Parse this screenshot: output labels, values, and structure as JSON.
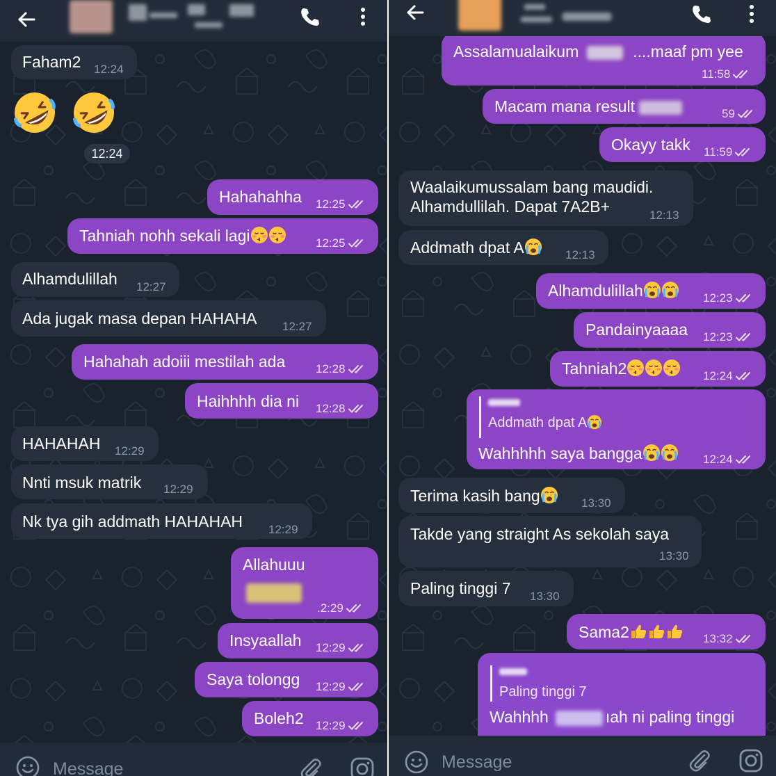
{
  "colors": {
    "background": "#1a222d",
    "header": "#222c39",
    "incoming_bubble": "#262f3c",
    "outgoing_bubble": "#8c45c4",
    "time_incoming": "#8c98a5",
    "time_outgoing": "#eadbf5"
  },
  "icons": {
    "back": "arrow-left-icon",
    "call": "phone-icon",
    "menu": "more-vertical-icon",
    "emoji": "smile-icon",
    "attach": "paperclip-icon",
    "camera": "instagram-camera-icon",
    "read": "double-check-icon"
  },
  "left": {
    "composer": {
      "placeholder": "Message"
    },
    "messages": [
      {
        "text": "Faham2",
        "time": "12:24"
      },
      {
        "emoji": "rolling-on-floor-laughing",
        "count": 2,
        "time": "12:24"
      },
      {
        "text": "Hahahahha",
        "time": "12:25",
        "read": true
      },
      {
        "text": "Tahniah nohh sekali lagi",
        "emoji": "kissing-blushing",
        "time": "12:25",
        "read": true
      },
      {
        "text": "Alhamdulillah",
        "time": "12:27"
      },
      {
        "text": "Ada jugak masa depan HAHAHA",
        "time": "12:27"
      },
      {
        "text": "Hahahah adoiii mestilah ada",
        "time": "12:28",
        "read": true
      },
      {
        "text": "Haihhhh dia ni",
        "time": "12:28",
        "read": true
      },
      {
        "text": "HAHAHAH",
        "time": "12:29"
      },
      {
        "text": "Nnti msuk matrik",
        "time": "12:29"
      },
      {
        "text": "Nk tya gih addmath HAHAHAH",
        "time": "12:29"
      },
      {
        "text": "Allahuuu",
        "time": ".2:29",
        "read": true
      },
      {
        "text": "Insyaallah",
        "time": "12:29",
        "read": true
      },
      {
        "text": "Saya tolongg",
        "time": "12:29",
        "read": true
      },
      {
        "text": "Boleh2",
        "time": "12:29",
        "read": true
      }
    ]
  },
  "right": {
    "composer": {
      "placeholder": "Message"
    },
    "messages": [
      {
        "text_a": "Assalamualaikum",
        "text_b": "....maaf pm yee",
        "time": "11:58",
        "read": true
      },
      {
        "text": "Macam mana result",
        "time": "59",
        "read": true
      },
      {
        "text": "Okayy takk",
        "time": "11:59",
        "read": true
      },
      {
        "line1": "Waalaikumussalam bang maudidi.",
        "line2": "Alhamdullilah. Dapat 7A2B+",
        "time": "12:13"
      },
      {
        "text": "Addmath dpat A",
        "emoji": "crying",
        "time": "12:13"
      },
      {
        "text": "Alhamdulillah",
        "emoji": "crying",
        "time": "12:23",
        "read": true
      },
      {
        "text": "Pandainyaaaa",
        "time": "12:23",
        "read": true
      },
      {
        "text": "Tahniah2",
        "emoji": "kissing-blushing",
        "time": "12:24",
        "read": true
      },
      {
        "reply_text": "Addmath dpat A",
        "text": "Wahhhhh saya bangga",
        "emoji": "crying",
        "time": "12:24",
        "read": true
      },
      {
        "text": "Terima kasih bang",
        "emoji": "crying",
        "time": "13:30"
      },
      {
        "text": "Takde yang straight As sekolah saya",
        "time": "13:30"
      },
      {
        "text": "Paling tinggi 7",
        "time": "13:30"
      },
      {
        "text": "Sama2",
        "emoji": "thumbs-up",
        "time": "13:32",
        "read": true
      },
      {
        "reply_text": "Paling tinggi 7",
        "text_a": "Wahhhh",
        "text_b": "ıah ni paling tinggi"
      }
    ]
  }
}
